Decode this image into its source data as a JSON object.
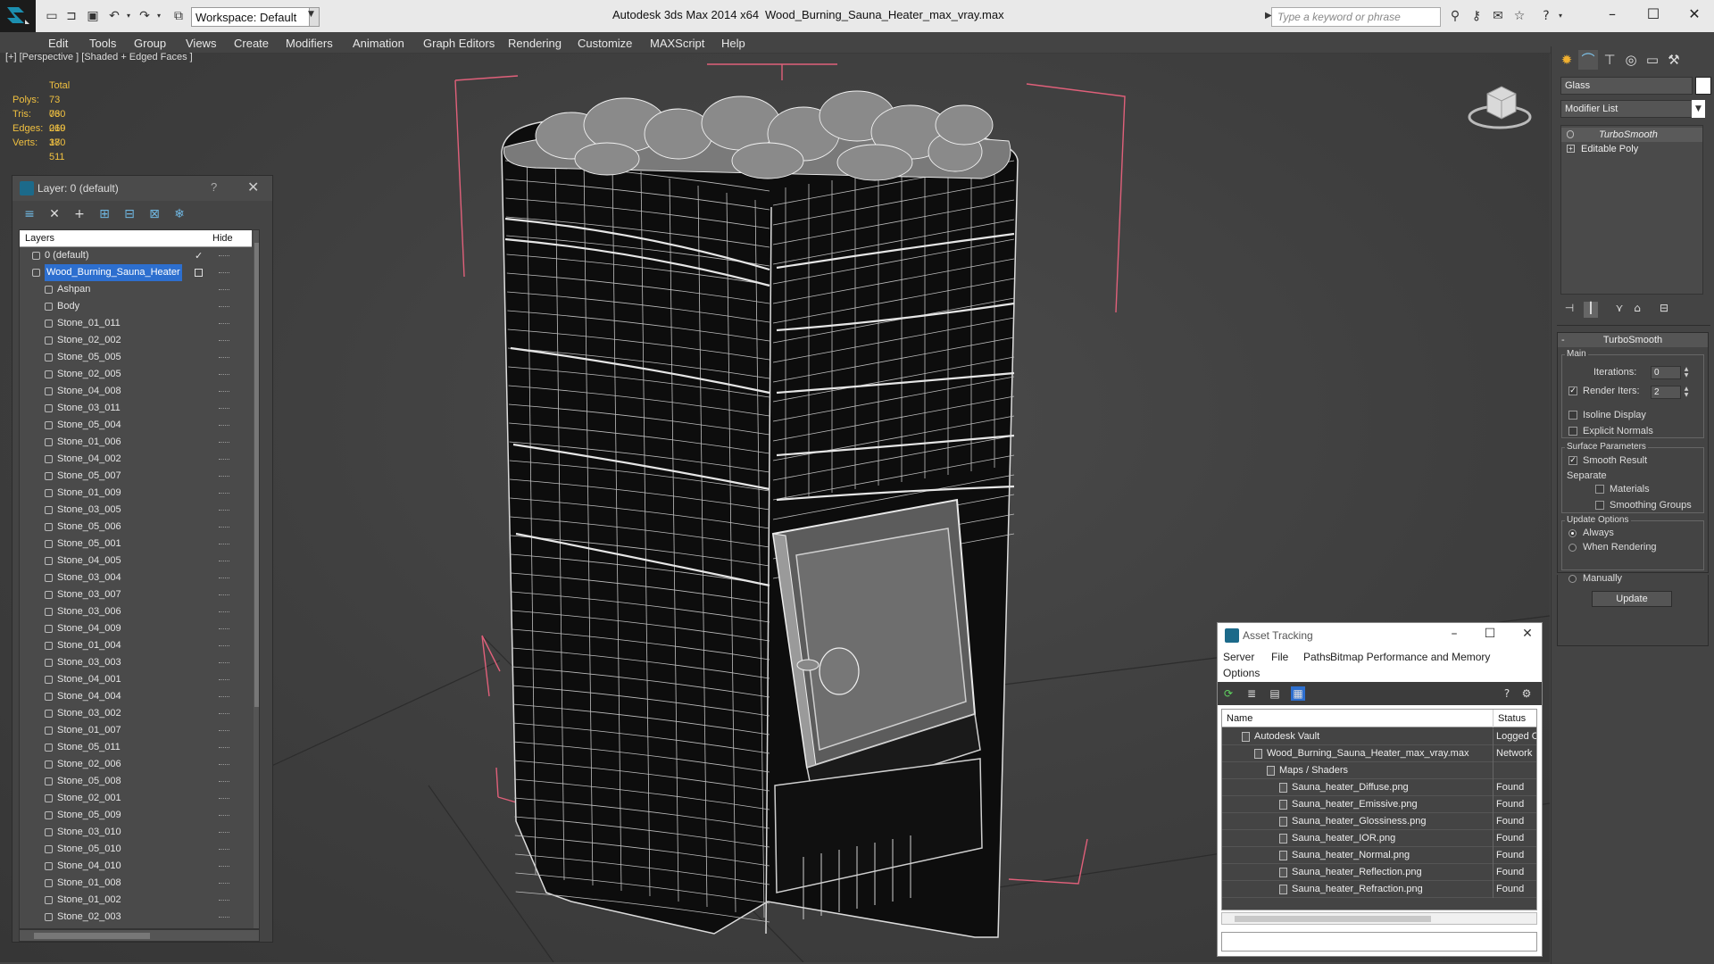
{
  "titlebar": {
    "workspace": "Workspace: Default",
    "app_title": "Autodesk 3ds Max  2014 x64",
    "file_title": "Wood_Burning_Sauna_Heater_max_vray.max",
    "search_placeholder": "Type a keyword or phrase"
  },
  "menu": [
    "Edit",
    "Tools",
    "Group",
    "Views",
    "Create",
    "Modifiers",
    "Animation",
    "Graph Editors",
    "Rendering",
    "Customize",
    "MAXScript",
    "Help"
  ],
  "viewport": {
    "label": "[+] [Perspective ] [Shaded + Edged Faces ]",
    "stats_header": "Total",
    "stats": [
      {
        "k": "Polys:",
        "v": "73 060"
      },
      {
        "k": "Tris:",
        "v": "73 060"
      },
      {
        "k": "Edges:",
        "v": "219 180"
      },
      {
        "k": "Verts:",
        "v": "37 511"
      }
    ]
  },
  "layers": {
    "title": "Layer: 0 (default)",
    "help": "?",
    "col_layers": "Layers",
    "col_hide": "Hide",
    "rows": [
      {
        "name": "0 (default)",
        "indent": 1,
        "check": "✓"
      },
      {
        "name": "Wood_Burning_Sauna_Heater",
        "indent": 1,
        "selected": true
      },
      {
        "name": "Ashpan",
        "indent": 2
      },
      {
        "name": "Body",
        "indent": 2
      },
      {
        "name": "Stone_01_011",
        "indent": 2
      },
      {
        "name": "Stone_02_002",
        "indent": 2
      },
      {
        "name": "Stone_05_005",
        "indent": 2
      },
      {
        "name": "Stone_02_005",
        "indent": 2
      },
      {
        "name": "Stone_04_008",
        "indent": 2
      },
      {
        "name": "Stone_03_011",
        "indent": 2
      },
      {
        "name": "Stone_05_004",
        "indent": 2
      },
      {
        "name": "Stone_01_006",
        "indent": 2
      },
      {
        "name": "Stone_04_002",
        "indent": 2
      },
      {
        "name": "Stone_05_007",
        "indent": 2
      },
      {
        "name": "Stone_01_009",
        "indent": 2
      },
      {
        "name": "Stone_03_005",
        "indent": 2
      },
      {
        "name": "Stone_05_006",
        "indent": 2
      },
      {
        "name": "Stone_05_001",
        "indent": 2
      },
      {
        "name": "Stone_04_005",
        "indent": 2
      },
      {
        "name": "Stone_03_004",
        "indent": 2
      },
      {
        "name": "Stone_03_007",
        "indent": 2
      },
      {
        "name": "Stone_03_006",
        "indent": 2
      },
      {
        "name": "Stone_04_009",
        "indent": 2
      },
      {
        "name": "Stone_01_004",
        "indent": 2
      },
      {
        "name": "Stone_03_003",
        "indent": 2
      },
      {
        "name": "Stone_04_001",
        "indent": 2
      },
      {
        "name": "Stone_04_004",
        "indent": 2
      },
      {
        "name": "Stone_03_002",
        "indent": 2
      },
      {
        "name": "Stone_01_007",
        "indent": 2
      },
      {
        "name": "Stone_05_011",
        "indent": 2
      },
      {
        "name": "Stone_02_006",
        "indent": 2
      },
      {
        "name": "Stone_05_008",
        "indent": 2
      },
      {
        "name": "Stone_02_001",
        "indent": 2
      },
      {
        "name": "Stone_05_009",
        "indent": 2
      },
      {
        "name": "Stone_03_010",
        "indent": 2
      },
      {
        "name": "Stone_05_010",
        "indent": 2
      },
      {
        "name": "Stone_04_010",
        "indent": 2
      },
      {
        "name": "Stone_01_008",
        "indent": 2
      },
      {
        "name": "Stone_01_002",
        "indent": 2
      },
      {
        "name": "Stone_02_003",
        "indent": 2
      }
    ]
  },
  "command_panel": {
    "object_name": "Glass",
    "modifier_list": "Modifier List",
    "stack": [
      "TurboSmooth",
      "Editable Poly"
    ],
    "turbosmooth": {
      "header": "TurboSmooth",
      "main": "Main",
      "iterations_label": "Iterations:",
      "iterations": "0",
      "render_iters_label": "Render Iters:",
      "render_iters": "2",
      "render_iters_checked": true,
      "isoline_display": "Isoline Display",
      "explicit_normals": "Explicit Normals",
      "surface_params": "Surface Parameters",
      "smooth_result": "Smooth Result",
      "separate": "Separate",
      "materials": "Materials",
      "smoothing_groups": "Smoothing Groups",
      "update_options": "Update Options",
      "always": "Always",
      "when_rendering": "When Rendering",
      "manually": "Manually",
      "update": "Update"
    }
  },
  "asset_tracking": {
    "title": "Asset Tracking",
    "menu": [
      "Server",
      "File",
      "Paths",
      "Bitmap Performance and Memory",
      "Options"
    ],
    "col_name": "Name",
    "col_status": "Status",
    "rows": [
      {
        "name": "Autodesk Vault",
        "status": "Logged O",
        "indent": 1
      },
      {
        "name": "Wood_Burning_Sauna_Heater_max_vray.max",
        "status": "Network",
        "indent": 2
      },
      {
        "name": "Maps / Shaders",
        "status": "",
        "indent": 3
      },
      {
        "name": "Sauna_heater_Diffuse.png",
        "status": "Found",
        "indent": 4
      },
      {
        "name": "Sauna_heater_Emissive.png",
        "status": "Found",
        "indent": 4
      },
      {
        "name": "Sauna_heater_Glossiness.png",
        "status": "Found",
        "indent": 4
      },
      {
        "name": "Sauna_heater_IOR.png",
        "status": "Found",
        "indent": 4
      },
      {
        "name": "Sauna_heater_Normal.png",
        "status": "Found",
        "indent": 4
      },
      {
        "name": "Sauna_heater_Reflection.png",
        "status": "Found",
        "indent": 4
      },
      {
        "name": "Sauna_heater_Refraction.png",
        "status": "Found",
        "indent": 4
      }
    ]
  },
  "colors": {
    "selection": "#2d6fcf",
    "stats_yellow": "#f0c040",
    "bbox_pink": "#e0607a",
    "wire": "#ffffff"
  }
}
